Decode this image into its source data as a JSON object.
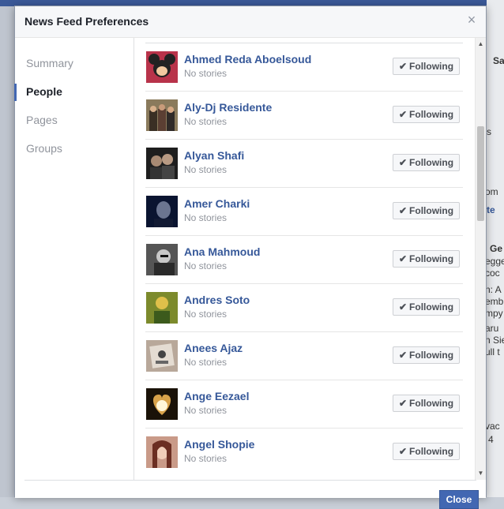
{
  "background": {
    "fragments": [
      "Sa",
      "s",
      "om",
      "te",
      "Ge",
      "egge",
      "coc",
      "n: A",
      "emb",
      "mpy",
      "aru",
      "n Sie",
      "ull t",
      "vac",
      "4"
    ]
  },
  "dialog": {
    "title": "News Feed Preferences",
    "close_icon": "×",
    "nav": [
      "Summary",
      "People",
      "Pages",
      "Groups"
    ],
    "active_nav": "People",
    "close_button_label": "Close",
    "people": [
      {
        "name": "Ahmed Reda Aboelsoud",
        "status": "No stories",
        "button": "Following"
      },
      {
        "name": "Aly-Dj Residente",
        "status": "No stories",
        "button": "Following"
      },
      {
        "name": "Alyan Shafi",
        "status": "No stories",
        "button": "Following"
      },
      {
        "name": "Amer Charki",
        "status": "No stories",
        "button": "Following"
      },
      {
        "name": "Ana Mahmoud",
        "status": "No stories",
        "button": "Following"
      },
      {
        "name": "Andres Soto",
        "status": "No stories",
        "button": "Following"
      },
      {
        "name": "Anees Ajaz",
        "status": "No stories",
        "button": "Following"
      },
      {
        "name": "Ange Eezael",
        "status": "No stories",
        "button": "Following"
      },
      {
        "name": "Angel Shopie",
        "status": "No stories",
        "button": "Following"
      }
    ]
  },
  "icons": {
    "check": "✔",
    "scroll_up": "▲",
    "scroll_down": "▼"
  },
  "colors": {
    "link": "#365899",
    "accent": "#4267b2"
  }
}
